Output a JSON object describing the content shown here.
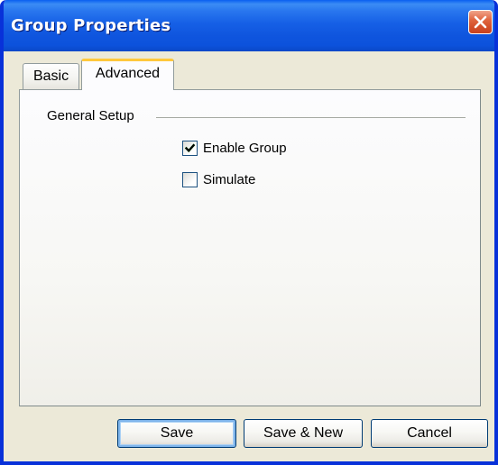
{
  "window": {
    "title": "Group Properties"
  },
  "tabs": [
    {
      "label": "Basic",
      "selected": false
    },
    {
      "label": "Advanced",
      "selected": true
    }
  ],
  "advanced": {
    "group_label": "General Setup",
    "checkboxes": [
      {
        "label": "Enable Group",
        "checked": true
      },
      {
        "label": "Simulate",
        "checked": false
      }
    ]
  },
  "buttons": {
    "save": "Save",
    "save_new": "Save & New",
    "cancel": "Cancel"
  },
  "icons": {
    "close": "close-icon",
    "check": "checkmark-icon"
  },
  "colors": {
    "titlebar": "#0a5ff0",
    "window_border": "#0831d9",
    "dialog_background": "#ece9d8",
    "close_button": "#d4502a",
    "active_tab_accent": "#ffc83c",
    "default_button_focus": "#7eb4ea"
  }
}
